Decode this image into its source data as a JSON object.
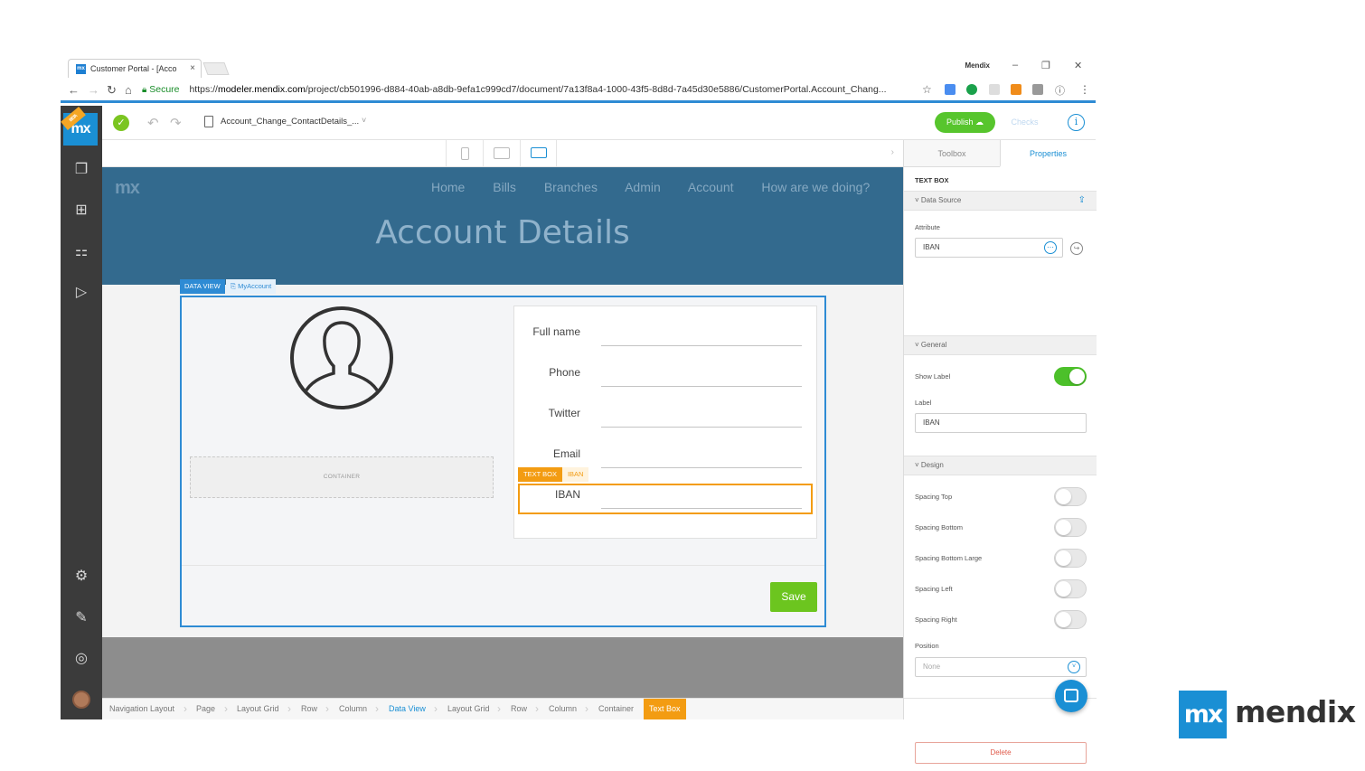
{
  "browser": {
    "tab_title": "Customer Portal - [Acco",
    "tab_close": "×",
    "favicon_text": "mx",
    "profile_name": "Mendix",
    "win_minimize": "–",
    "win_restore": "❐",
    "win_close": "✕",
    "secure_label": "Secure",
    "url_scheme": "https://",
    "url_host": "modeler.mendix.com",
    "url_path": "/project/cb501996-d884-40ab-a8db-9efa1c999cd7/document/7a13f8a4-1000-43f5-8d8d-7a45d30e5886/CustomerPortal.Account_Chang..."
  },
  "sidebar": {
    "logo_text": "mx",
    "beta_text": "BETA",
    "icons": [
      "pages-icon",
      "doc-tree-icon",
      "hierarchy-icon",
      "play-icon",
      "settings-icon",
      "brush-icon",
      "megaphone-icon",
      "user-avatar"
    ]
  },
  "topbar": {
    "document_name": "Account_Change_ContactDetails_...",
    "chevron": "˅",
    "publish_label": "Publish",
    "checks_label": "Checks",
    "info_label": "i"
  },
  "page": {
    "logo": "mx",
    "nav": [
      "Home",
      "Bills",
      "Branches",
      "Admin",
      "Account",
      "How are we doing?"
    ],
    "title": "Account Details",
    "data_view_tag": "DATA VIEW",
    "data_view_entity": "MyAccount",
    "container_label": "CONTAINER",
    "fields": [
      "Full name",
      "Phone",
      "Twitter",
      "Email",
      "IBAN"
    ],
    "text_box_tag": "TEXT BOX",
    "text_box_attr": "IBAN",
    "save_label": "Save"
  },
  "breadcrumb": [
    "Navigation Layout",
    "Page",
    "Layout Grid",
    "Row",
    "Column",
    "Data View",
    "Layout Grid",
    "Row",
    "Column",
    "Container",
    "Text Box"
  ],
  "properties": {
    "tabs": [
      "Toolbox",
      "Properties"
    ],
    "widget_type": "TEXT BOX",
    "data_source_header": "Data Source",
    "attribute_label": "Attribute",
    "attribute_value": "IBAN",
    "general_header": "General",
    "show_label_label": "Show Label",
    "show_label_on": true,
    "label_label": "Label",
    "label_value": "IBAN",
    "design_header": "Design",
    "design_toggles": [
      {
        "label": "Spacing Top",
        "on": false
      },
      {
        "label": "Spacing Bottom",
        "on": false
      },
      {
        "label": "Spacing Bottom Large",
        "on": false
      },
      {
        "label": "Spacing Left",
        "on": false
      },
      {
        "label": "Spacing Right",
        "on": false
      }
    ],
    "position_label": "Position",
    "position_value": "None",
    "delete_label": "Delete"
  },
  "brand": {
    "box_text": "mx",
    "word": "mendix"
  },
  "colors": {
    "brand_blue": "#1a8fd4",
    "publish_green": "#57c52d",
    "selection_orange": "#f39c12",
    "hero_blue": "#336a8e"
  }
}
